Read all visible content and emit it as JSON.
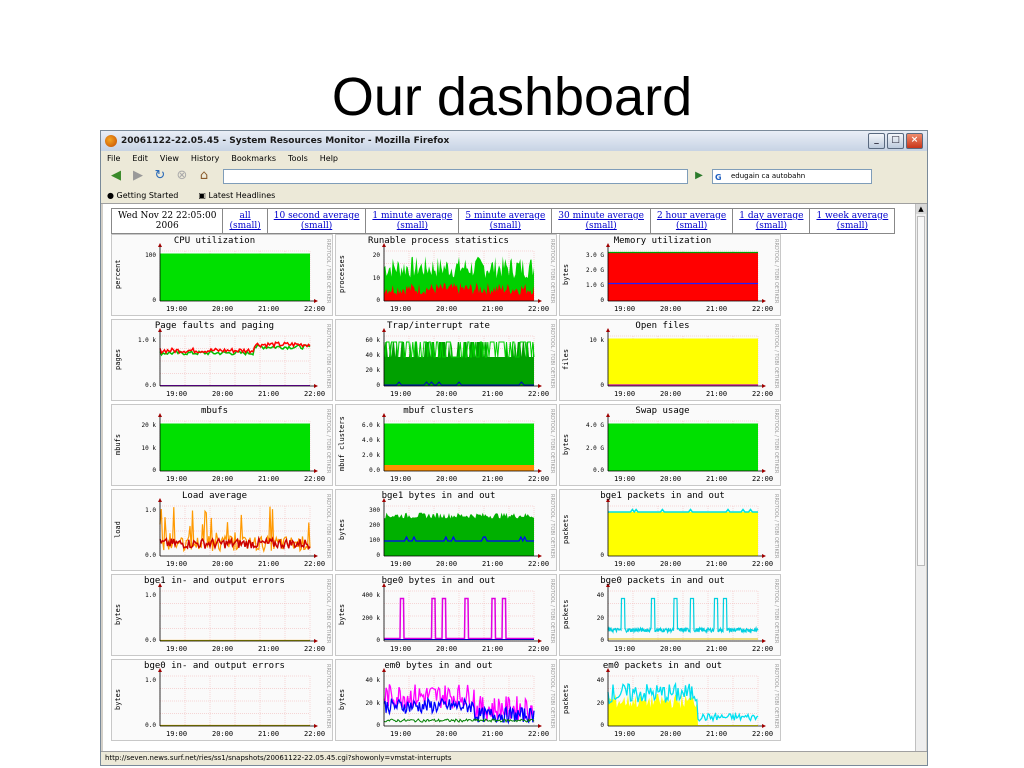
{
  "slide": {
    "title": "Our dashboard"
  },
  "window": {
    "title": "20061122-22.05.45 - System Resources Monitor - Mozilla Firefox",
    "controls": [
      "_",
      "□",
      "×"
    ]
  },
  "menu": [
    "File",
    "Edit",
    "View",
    "History",
    "Bookmarks",
    "Tools",
    "Help"
  ],
  "nav": {
    "url": "",
    "search_value": "edugain ca autobahn",
    "search_engine": "G"
  },
  "bookmarks": [
    "Getting Started",
    "Latest Headlines"
  ],
  "date_cell": {
    "line1": "Wed Nov 22 22:05:00",
    "line2": "2006"
  },
  "averages": [
    {
      "label": "all",
      "small": "(small)"
    },
    {
      "label": "10 second average",
      "small": "(small)"
    },
    {
      "label": "1 minute average",
      "small": "(small)"
    },
    {
      "label": "5 minute average",
      "small": "(small)"
    },
    {
      "label": "30 minute average",
      "small": "(small)"
    },
    {
      "label": "2 hour average",
      "small": "(small)"
    },
    {
      "label": "1 day average",
      "small": "(small)"
    },
    {
      "label": "1 week average",
      "small": "(small)"
    }
  ],
  "status_text": "http://seven.news.surf.net/ries/ss1/snapshots/20061122-22.05.45.cgi?showonly=vmstat-interrupts",
  "rrd_credit": "RRDTOOL / TOBI OETIKER",
  "chart_data": [
    {
      "type": "area",
      "title": "CPU utilization",
      "ylabel": "percent",
      "yticks": [
        "100",
        "0"
      ],
      "xticks": [
        "19:00",
        "20:00",
        "21:00",
        "22:00"
      ],
      "style": "full-green"
    },
    {
      "type": "area",
      "title": "Runable process statistics",
      "ylabel": "processes",
      "yticks": [
        "20",
        "10",
        "0"
      ],
      "xticks": [
        "19:00",
        "20:00",
        "21:00",
        "22:00"
      ],
      "style": "noisy-green-red"
    },
    {
      "type": "area",
      "title": "Memory utilization",
      "ylabel": "bytes",
      "yticks": [
        "3.0 G",
        "2.0 G",
        "1.0 G",
        "0"
      ],
      "xticks": [
        "19:00",
        "20:00",
        "21:00",
        "22:00"
      ],
      "style": "full-red"
    },
    {
      "type": "line",
      "title": "Page faults and paging",
      "ylabel": "pages",
      "yticks": [
        "1.0 k",
        "0.0"
      ],
      "xticks": [
        "19:00",
        "20:00",
        "21:00",
        "22:00"
      ],
      "style": "redgreen-band"
    },
    {
      "type": "line",
      "title": "Trap/interrupt rate",
      "ylabel": "",
      "yticks": [
        "60 k",
        "40 k",
        "20 k",
        "0"
      ],
      "xticks": [
        "19:00",
        "20:00",
        "21:00",
        "22:00"
      ],
      "style": "green-spiky"
    },
    {
      "type": "area",
      "title": "Open files",
      "ylabel": "files",
      "yticks": [
        "10 k",
        "0"
      ],
      "xticks": [
        "19:00",
        "20:00",
        "21:00",
        "22:00"
      ],
      "style": "full-yellow"
    },
    {
      "type": "area",
      "title": "mbufs",
      "ylabel": "mbufs",
      "yticks": [
        "20 k",
        "10 k",
        "0"
      ],
      "xticks": [
        "19:00",
        "20:00",
        "21:00",
        "22:00"
      ],
      "style": "full-green"
    },
    {
      "type": "area",
      "title": "mbuf clusters",
      "ylabel": "mbuf clusters",
      "yticks": [
        "6.0 k",
        "4.0 k",
        "2.0 k",
        "0.0"
      ],
      "xticks": [
        "19:00",
        "20:00",
        "21:00",
        "22:00"
      ],
      "style": "green-orange"
    },
    {
      "type": "area",
      "title": "Swap usage",
      "ylabel": "bytes",
      "yticks": [
        "4.0 G",
        "2.0 G",
        "0.0"
      ],
      "xticks": [
        "19:00",
        "20:00",
        "21:00",
        "22:00"
      ],
      "style": "full-green"
    },
    {
      "type": "line",
      "title": "Load average",
      "ylabel": "load",
      "yticks": [
        "1.0",
        "0.0"
      ],
      "xticks": [
        "19:00",
        "20:00",
        "21:00",
        "22:00"
      ],
      "style": "orange-red-spiky"
    },
    {
      "type": "area",
      "title": "bge1 bytes in and out",
      "ylabel": "bytes",
      "yticks": [
        "300",
        "200",
        "100",
        "0"
      ],
      "xticks": [
        "19:00",
        "20:00",
        "21:00",
        "22:00"
      ],
      "style": "dark-green"
    },
    {
      "type": "area",
      "title": "bge1 packets in and out",
      "ylabel": "packets",
      "yticks": [
        "0"
      ],
      "xticks": [
        "19:00",
        "20:00",
        "21:00",
        "22:00"
      ],
      "style": "yellow-cyan"
    },
    {
      "type": "line",
      "title": "bge1 in- and output errors",
      "ylabel": "bytes",
      "yticks": [
        "1.0",
        "0.0"
      ],
      "xticks": [
        "19:00",
        "20:00",
        "21:00",
        "22:00"
      ],
      "style": "flat"
    },
    {
      "type": "line",
      "title": "bge0 bytes in and out",
      "ylabel": "bytes",
      "yticks": [
        "400 k",
        "200 k",
        "0"
      ],
      "xticks": [
        "19:00",
        "20:00",
        "21:00",
        "22:00"
      ],
      "style": "magenta-spikes"
    },
    {
      "type": "line",
      "title": "bge0 packets in and out",
      "ylabel": "packets",
      "yticks": [
        "40",
        "20",
        "0"
      ],
      "xticks": [
        "19:00",
        "20:00",
        "21:00",
        "22:00"
      ],
      "style": "cyan-spikes"
    },
    {
      "type": "line",
      "title": "bge0 in- and output errors",
      "ylabel": "bytes",
      "yticks": [
        "1.0",
        "0.0"
      ],
      "xticks": [
        "19:00",
        "20:00",
        "21:00",
        "22:00"
      ],
      "style": "flat"
    },
    {
      "type": "line",
      "title": "em0 bytes in and out",
      "ylabel": "bytes",
      "yticks": [
        "40 k",
        "20 k",
        "0"
      ],
      "xticks": [
        "19:00",
        "20:00",
        "21:00",
        "22:00"
      ],
      "style": "magenta-blue-noisy"
    },
    {
      "type": "area",
      "title": "em0 packets in and out",
      "ylabel": "packets",
      "yticks": [
        "40",
        "20",
        "0"
      ],
      "xticks": [
        "19:00",
        "20:00",
        "21:00",
        "22:00"
      ],
      "style": "yellow-cyan-decay"
    }
  ]
}
